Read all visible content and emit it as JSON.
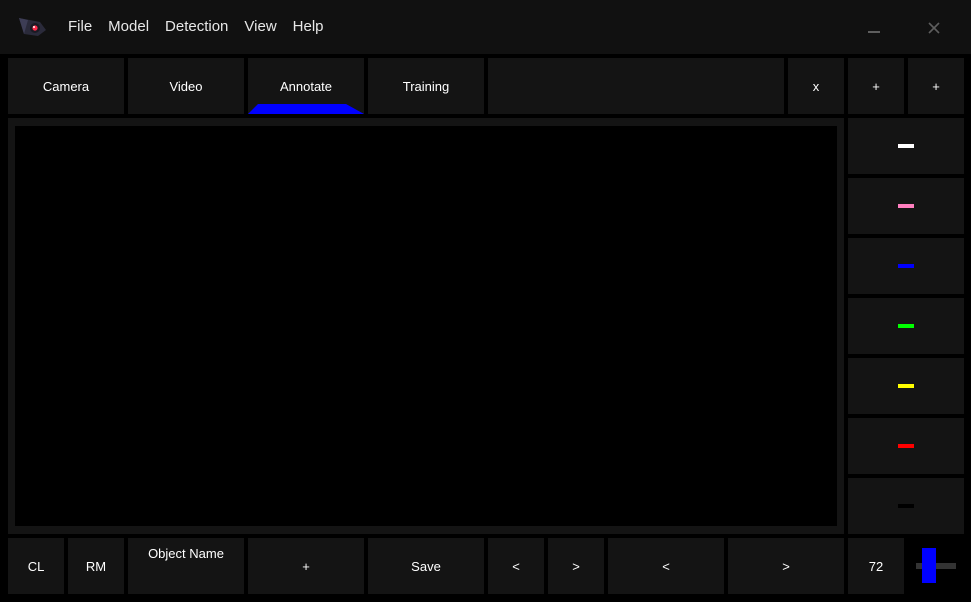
{
  "menu": {
    "items": [
      "File",
      "Model",
      "Detection",
      "View",
      "Help"
    ]
  },
  "window_controls": {
    "minimize_glyph": "—",
    "close_glyph": "✕"
  },
  "tabs": {
    "items": [
      "Camera",
      "Video",
      "Annotate",
      "Training"
    ],
    "active": "Annotate",
    "active_color": "#0000ff"
  },
  "toolbar_right": {
    "close_label": "x",
    "add_label_1": "+",
    "add_label_2": "+"
  },
  "color_swatches": [
    {
      "name": "white",
      "color": "#ffffff"
    },
    {
      "name": "pink",
      "color": "#ff7fbf"
    },
    {
      "name": "blue",
      "color": "#0000ff"
    },
    {
      "name": "green",
      "color": "#00ff00"
    },
    {
      "name": "yellow",
      "color": "#ffff00"
    },
    {
      "name": "red",
      "color": "#ff0000"
    },
    {
      "name": "black",
      "color": "#000000"
    }
  ],
  "bottom_bar": {
    "cl_label": "CL",
    "rm_label": "RM",
    "object_name_label": "Object Name",
    "add_label": "+",
    "save_label": "Save",
    "prev_small_label": "<",
    "next_small_label": ">",
    "prev_large_label": "<",
    "next_large_label": ">",
    "value": "72"
  },
  "slider": {
    "color": "#0000ff"
  },
  "icons": {
    "app_logo": "eye-camera-icon",
    "minimize": "minimize-icon",
    "close": "close-icon"
  }
}
